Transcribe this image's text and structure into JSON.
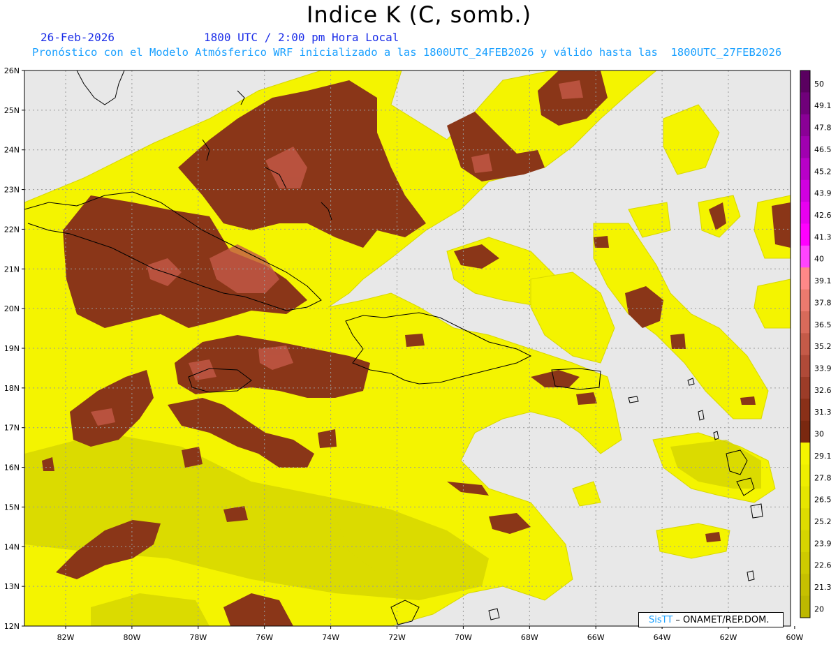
{
  "header": {
    "title": "Indice K (C, somb.)",
    "date": "26-Feb-2026",
    "time": "1800 UTC / 2:00 pm Hora Local",
    "model_line": "Pronóstico con el Modelo Atmósferico WRF inicializado a las 1800UTC_24FEB2026 y válido hasta las  1800UTC_27FEB2026"
  },
  "map": {
    "lat_labels": [
      "26N",
      "25N",
      "24N",
      "23N",
      "22N",
      "21N",
      "20N",
      "19N",
      "18N",
      "17N",
      "16N",
      "15N",
      "14N",
      "13N",
      "12N"
    ],
    "lon_labels": [
      "82W",
      "80W",
      "78W",
      "76W",
      "74W",
      "72W",
      "70W",
      "68W",
      "66W",
      "64W",
      "62W",
      "60W"
    ],
    "colors": {
      "background": "#e8e8e8",
      "yellow": "#f4f400",
      "olive": "#d3d300",
      "brown": "#8a3618",
      "rust": "#b3523a",
      "salmon": "#cc6a5a"
    }
  },
  "colorbar": {
    "labels": [
      "50",
      "49.1",
      "47.8",
      "46.5",
      "45.2",
      "43.9",
      "42.6",
      "41.3",
      "40",
      "39.1",
      "37.8",
      "36.5",
      "35.2",
      "33.9",
      "32.6",
      "31.3",
      "30",
      "29.1",
      "27.8",
      "26.5",
      "25.2",
      "23.9",
      "22.6",
      "21.3",
      "20"
    ],
    "colors": [
      "#5a0060",
      "#70007a",
      "#8a0096",
      "#a000b0",
      "#b800c8",
      "#d000e0",
      "#e800f0",
      "#ff00ff",
      "#ff44ff",
      "#ff8888",
      "#ec7a6e",
      "#d86a5a",
      "#c45a48",
      "#b04a38",
      "#9c3c28",
      "#8a3018",
      "#7a2810",
      "#f4f400",
      "#eeee00",
      "#e6e600",
      "#dedc00",
      "#d6d400",
      "#ceca00",
      "#c6c000",
      "#bdb800"
    ]
  },
  "credit": {
    "brand": "SisTT",
    "org": " – ONAMET/REP.DOM."
  }
}
